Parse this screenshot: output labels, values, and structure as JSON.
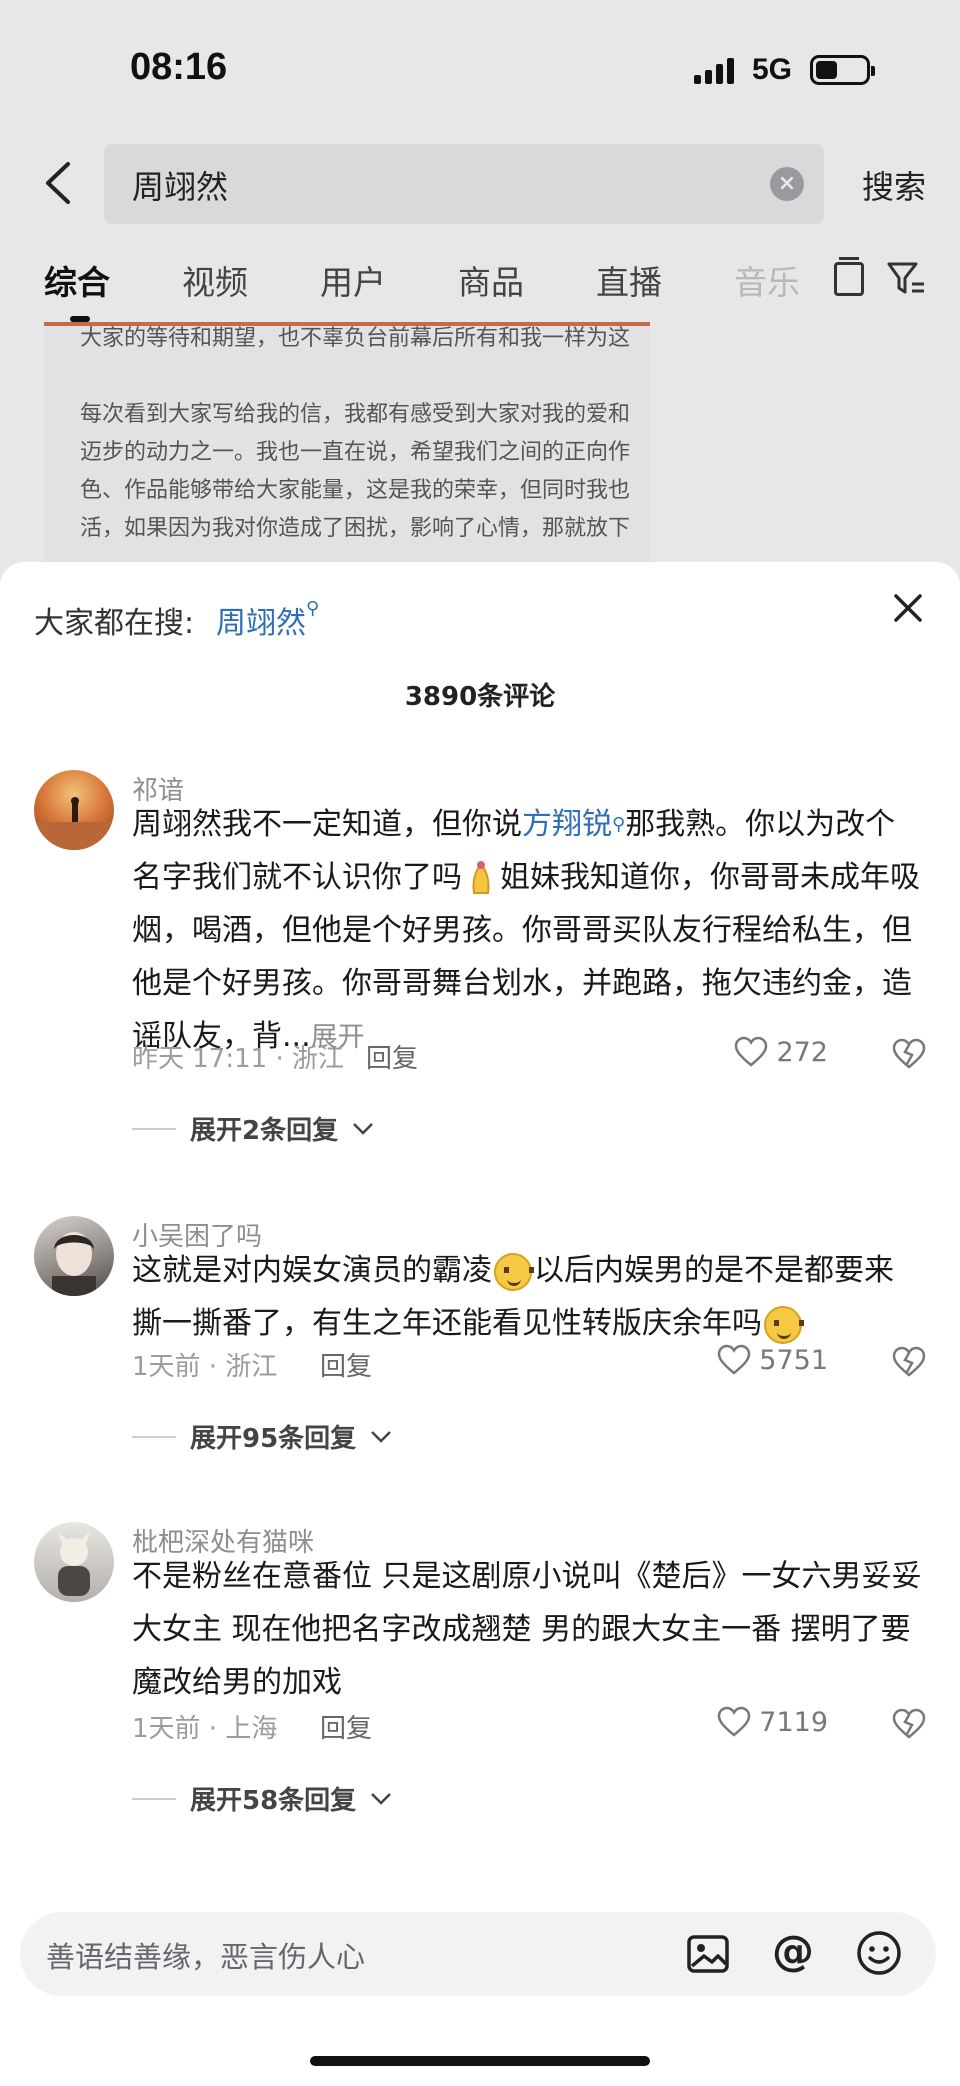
{
  "status_bar": {
    "time": "08:16",
    "network": "5G"
  },
  "search": {
    "query": "周翊然",
    "button_label": "搜索"
  },
  "tabs": [
    {
      "label": "综合"
    },
    {
      "label": "视频"
    },
    {
      "label": "用户"
    },
    {
      "label": "商品"
    },
    {
      "label": "直播"
    },
    {
      "label": "音乐"
    }
  ],
  "article_preview": {
    "lines": [
      "大家的等待和期望，也不辜负台前幕后所有和我一样为这",
      "",
      "每次看到大家写给我的信，我都有感受到大家对我的爱和",
      "迈步的动力之一。我也一直在说，希望我们之间的正向作",
      "色、作品能够带给大家能量，这是我的荣幸，但同时我也",
      "活，如果因为我对你造成了困扰，影响了心情，那就放下"
    ]
  },
  "sheet": {
    "trending_label": "大家都在搜:",
    "trending_link": "周翊然",
    "comment_count": "3890条评论"
  },
  "comments": [
    {
      "username": "祁谙",
      "text_1": "周翊然我不一定知道，但你说",
      "mention": "方翔锐",
      "text_2": "那我熟。你以为改个名字我们就不认识你了吗",
      "text_3": "姐妹我知道你，你哥哥未成年吸烟，喝酒，但他是个好男孩。你哥哥买队友行程给私生，但他是个好男孩。你哥哥舞台划水，并跑路，拖欠违约金，造谣队友，背...",
      "expand": "展开",
      "time_location": "昨天 17:11 · 浙江",
      "reply": "回复",
      "likes": "272",
      "replies_label": "展开2条回复"
    },
    {
      "username": "小吴困了吗",
      "text_1": "这就是对内娱女演员的霸凌",
      "text_2": "以后内娱男的是不是都要来撕一撕番了，有生之年还能看见性转版庆余年吗",
      "time_location": "1天前 · 浙江",
      "reply": "回复",
      "likes": "5751",
      "replies_label": "展开95条回复"
    },
    {
      "username": "枇杷深处有猫咪",
      "text_1": "不是粉丝在意番位 只是这剧原小说叫《楚后》一女六男妥妥大女主 现在他把名字改成翘楚 男的跟大女主一番 摆明了要魔改给男的加戏",
      "time_location": "1天前 · 上海",
      "reply": "回复",
      "likes": "7119",
      "replies_label": "展开58条回复"
    }
  ],
  "input": {
    "placeholder": "善语结善缘，恶言伤人心",
    "at_symbol": "@"
  }
}
